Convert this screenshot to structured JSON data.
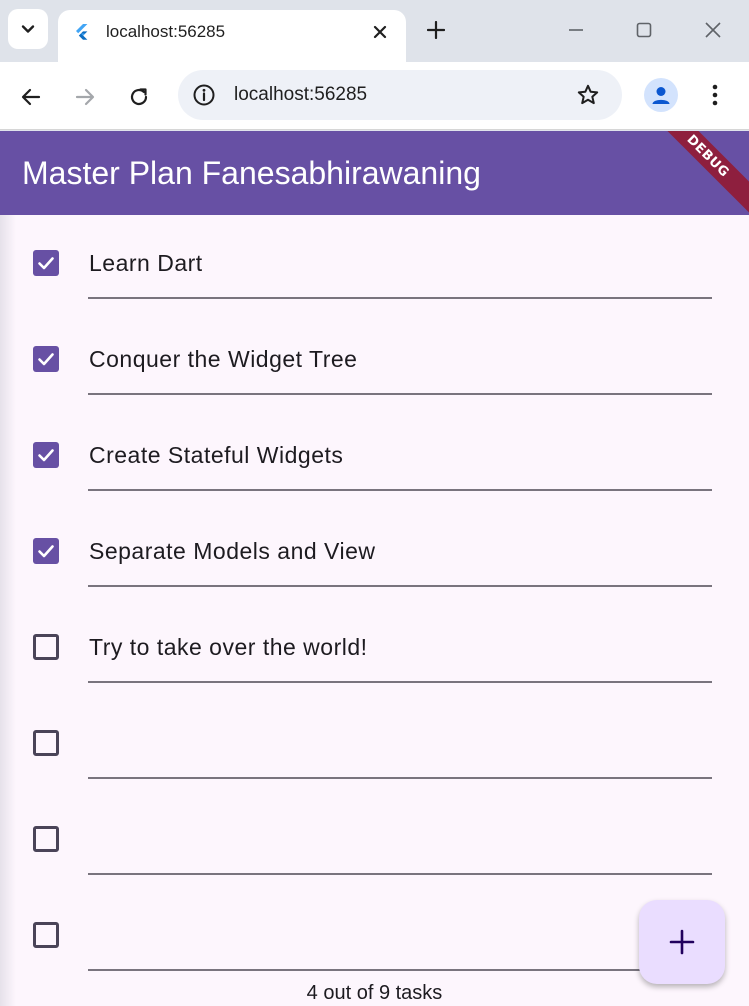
{
  "browser": {
    "tab_title": "localhost:56285",
    "url": "localhost:56285",
    "colors": {
      "tabbar": "#dfe3ea",
      "toolbar": "#ffffff",
      "omnibox": "#eef1f7"
    }
  },
  "app": {
    "title": "Master Plan Fanesabhirawaning",
    "debug_banner": "DEBUG",
    "colors": {
      "primary": "#6750a4",
      "background": "#fdf6fd",
      "fab": "#eaddff"
    },
    "tasks": [
      {
        "label": "Learn Dart",
        "checked": true
      },
      {
        "label": "Conquer the Widget Tree",
        "checked": true
      },
      {
        "label": "Create Stateful Widgets",
        "checked": true
      },
      {
        "label": "Separate Models and View",
        "checked": true
      },
      {
        "label": "Try to take over the world!",
        "checked": false
      },
      {
        "label": "",
        "checked": false
      },
      {
        "label": "",
        "checked": false
      },
      {
        "label": "",
        "checked": false
      }
    ],
    "footer": "4 out of 9 tasks",
    "fab_icon": "add-icon"
  }
}
